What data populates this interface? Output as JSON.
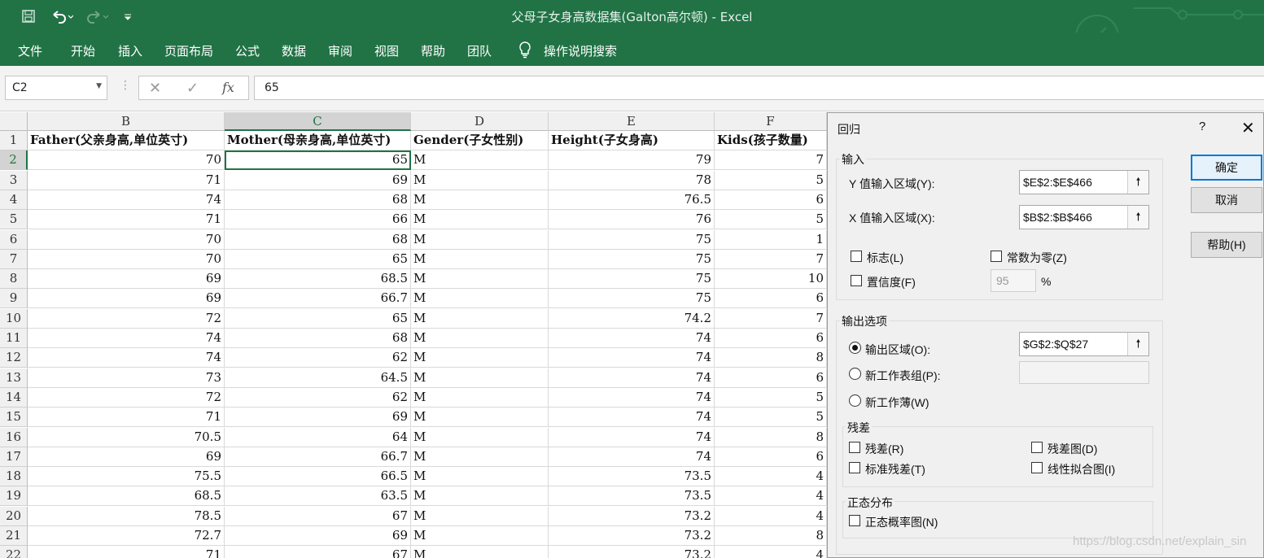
{
  "window": {
    "title": "父母子女身高数据集(Galton高尔顿)  -  Excel"
  },
  "ribbon": {
    "tabs": [
      "文件",
      "开始",
      "插入",
      "页面布局",
      "公式",
      "数据",
      "审阅",
      "视图",
      "帮助",
      "团队"
    ],
    "tell_me": "操作说明搜索"
  },
  "formula_bar": {
    "name_box": "C2",
    "formula": "65",
    "fx": "fx"
  },
  "sheet": {
    "columns": [
      "B",
      "C",
      "D",
      "E",
      "F"
    ],
    "selected_column": "C",
    "row_numbers": [
      "1",
      "2",
      "3",
      "4",
      "5",
      "6",
      "7",
      "8",
      "9",
      "10",
      "11",
      "12",
      "13",
      "14",
      "15",
      "16",
      "17",
      "18",
      "19",
      "20",
      "21",
      "22"
    ],
    "header_row": [
      "Father(父亲身高,单位英寸)",
      "Mother(母亲身高,单位英寸)",
      "Gender(子女性别)",
      "Height(子女身高)",
      "Kids(孩子数量)"
    ],
    "rows": [
      [
        "70",
        "65",
        "M",
        "79",
        "7"
      ],
      [
        "71",
        "69",
        "M",
        "78",
        "5"
      ],
      [
        "74",
        "68",
        "M",
        "76.5",
        "6"
      ],
      [
        "71",
        "66",
        "M",
        "76",
        "5"
      ],
      [
        "70",
        "68",
        "M",
        "75",
        "1"
      ],
      [
        "70",
        "65",
        "M",
        "75",
        "7"
      ],
      [
        "69",
        "68.5",
        "M",
        "75",
        "10"
      ],
      [
        "69",
        "66.7",
        "M",
        "75",
        "6"
      ],
      [
        "72",
        "65",
        "M",
        "74.2",
        "7"
      ],
      [
        "74",
        "68",
        "M",
        "74",
        "6"
      ],
      [
        "74",
        "62",
        "M",
        "74",
        "8"
      ],
      [
        "73",
        "64.5",
        "M",
        "74",
        "6"
      ],
      [
        "72",
        "62",
        "M",
        "74",
        "5"
      ],
      [
        "71",
        "69",
        "M",
        "74",
        "5"
      ],
      [
        "70.5",
        "64",
        "M",
        "74",
        "8"
      ],
      [
        "69",
        "66.7",
        "M",
        "74",
        "6"
      ],
      [
        "75.5",
        "66.5",
        "M",
        "73.5",
        "4"
      ],
      [
        "68.5",
        "63.5",
        "M",
        "73.5",
        "4"
      ],
      [
        "78.5",
        "67",
        "M",
        "73.2",
        "4"
      ],
      [
        "72.7",
        "69",
        "M",
        "73.2",
        "8"
      ],
      [
        "71",
        "67",
        "M",
        "73.2",
        "4"
      ]
    ]
  },
  "dialog": {
    "title": "回归",
    "help_glyph": "?",
    "close_glyph": "✕",
    "input_group": "输入",
    "y_label": "Y 值输入区域(Y):",
    "y_value": "$E$2:$E$466",
    "x_label": "X 值输入区域(X):",
    "x_value": "$B$2:$B$466",
    "labels_chk": "标志(L)",
    "const_zero_chk": "常数为零(Z)",
    "confidence_chk": "置信度(F)",
    "confidence_value": "95",
    "percent": "%",
    "output_group": "输出选项",
    "output_range": "输出区域(O):",
    "output_value": "$G$2:$Q$27",
    "new_sheet": "新工作表组(P):",
    "new_book": "新工作薄(W)",
    "residual_group": "残差",
    "residuals": "残差(R)",
    "residual_plots": "残差图(D)",
    "std_residuals": "标准残差(T)",
    "line_fit": "线性拟合图(I)",
    "normal_group": "正态分布",
    "normal_plot": "正态概率图(N)",
    "ok": "确定",
    "cancel": "取消",
    "help": "帮助(H)"
  },
  "watermark": "https://blog.csdn.net/explain_sin"
}
